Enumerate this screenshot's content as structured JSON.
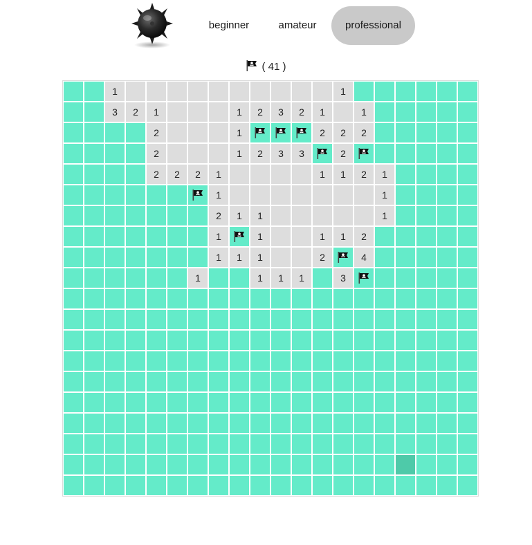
{
  "header": {
    "logo_icon": "mine-bomb-icon",
    "levels": [
      {
        "label": "beginner",
        "active": false
      },
      {
        "label": "amateur",
        "active": false
      },
      {
        "label": "professional",
        "active": true
      }
    ]
  },
  "counter": {
    "icon": "pirate-flag-icon",
    "text": "( 41 )"
  },
  "colors": {
    "hidden": "#64ebc9",
    "revealed": "#dddddd",
    "hover": "#4ecaa9",
    "active_button": "#c9c9c9"
  },
  "board": {
    "cols": 20,
    "legend": {
      "#": "hidden",
      ".": "revealed empty",
      "1-8": "revealed number",
      "F": "flag",
      "H": "hovered hidden cell"
    },
    "rows": [
      "##1..........1######",
      "##321...12321.1######",
      "####2...1FFF222######",
      "####2...1233F2F######",
      "####2221....1121######",
      "######F1.......1######",
      "#######211.....1######",
      "#######1F1..112######",
      "#######111..2F4######",
      "######1##111#3F######",
      "####################",
      "####################",
      "####################",
      "####################",
      "####################",
      "####################",
      "####################",
      "####################",
      "################H###",
      "####################"
    ]
  }
}
